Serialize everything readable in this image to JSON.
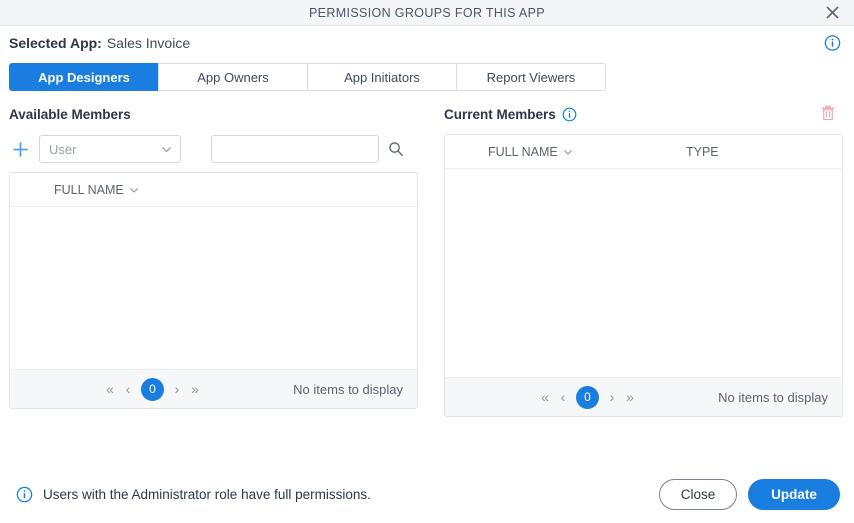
{
  "window": {
    "title": "PERMISSION GROUPS FOR THIS APP",
    "close_icon": "close-icon"
  },
  "header": {
    "selected_app_label": "Selected App:",
    "selected_app_value": "Sales Invoice",
    "info_icon": "info-icon"
  },
  "tabs": [
    {
      "label": "App Designers",
      "active": true
    },
    {
      "label": "App Owners",
      "active": false
    },
    {
      "label": "App Initiators",
      "active": false
    },
    {
      "label": "Report Viewers",
      "active": false
    }
  ],
  "available_members": {
    "title": "Available Members",
    "add_icon": "plus-icon",
    "type_select": {
      "value": "User",
      "chevron_icon": "chevron-down-icon"
    },
    "search": {
      "value": "",
      "placeholder": "",
      "icon": "search-icon"
    },
    "columns": [
      {
        "label": "FULL NAME",
        "sort_icon": "chevron-down-icon"
      }
    ],
    "rows": [],
    "pager": {
      "first_icon": "«",
      "prev_icon": "‹",
      "page": "0",
      "next_icon": "›",
      "last_icon": "»"
    },
    "empty_text": "No items to display"
  },
  "current_members": {
    "title": "Current Members",
    "info_icon": "info-icon",
    "delete_icon": "trash-icon",
    "columns": [
      {
        "label": "FULL NAME",
        "sort_icon": "chevron-down-icon"
      },
      {
        "label": "TYPE",
        "sort_icon": ""
      }
    ],
    "rows": [],
    "pager": {
      "first_icon": "«",
      "prev_icon": "‹",
      "page": "0",
      "next_icon": "›",
      "last_icon": "»"
    },
    "empty_text": "No items to display"
  },
  "footer": {
    "note_icon": "info-icon",
    "note": "Users with the Administrator role have full permissions.",
    "close_button": "Close",
    "update_button": "Update"
  },
  "colors": {
    "accent_blue": "#1a7ee0",
    "titlebar_bg": "#f4f5f7",
    "grid_footer_bg": "#f6f7f9",
    "border": "#e1e4e8",
    "text_dark": "#2d3748",
    "text_muted": "#5c6470",
    "placeholder": "#9aa2ad",
    "trash_disabled": "#e8a3ab"
  }
}
